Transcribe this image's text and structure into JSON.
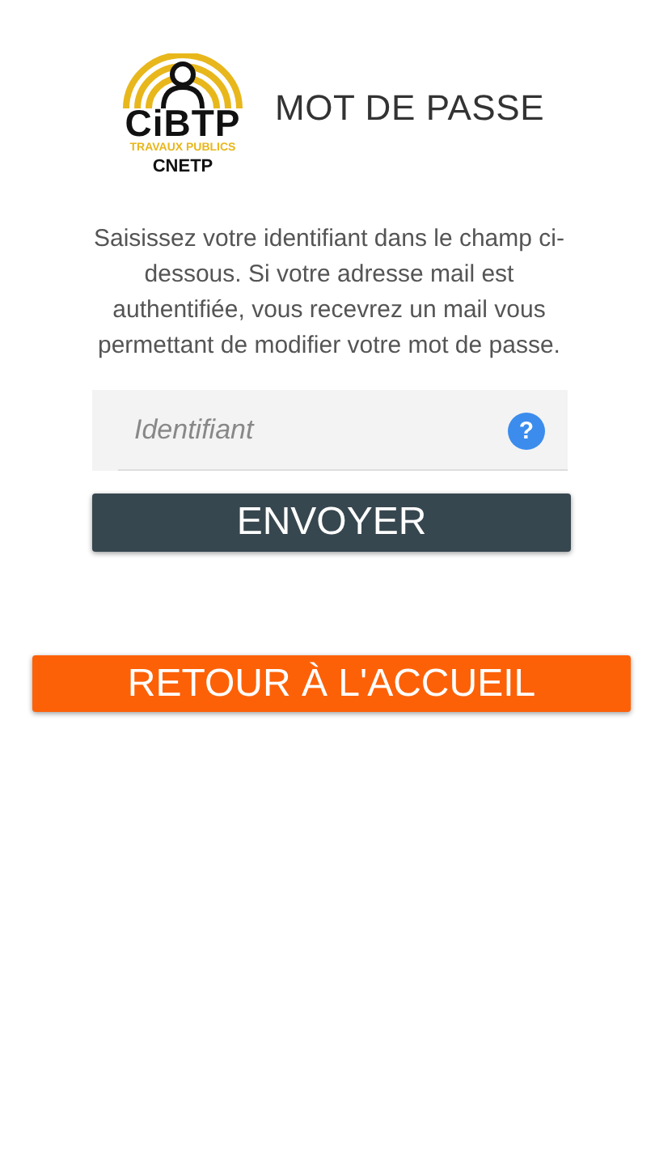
{
  "logo": {
    "name": "CiBTP",
    "subtitle": "TRAVAUX PUBLICS",
    "org": "CNETP"
  },
  "title": "MOT DE PASSE",
  "instructions": "Saisissez votre identifiant dans le champ ci-dessous. Si votre adresse mail est authentifiée, vous recevrez un mail vous permettant de modifier votre mot de passe.",
  "identifier_field": {
    "placeholder": "Identifiant",
    "help": "?"
  },
  "submit_button": "ENVOYER",
  "home_button": "RETOUR À L'ACCUEIL"
}
